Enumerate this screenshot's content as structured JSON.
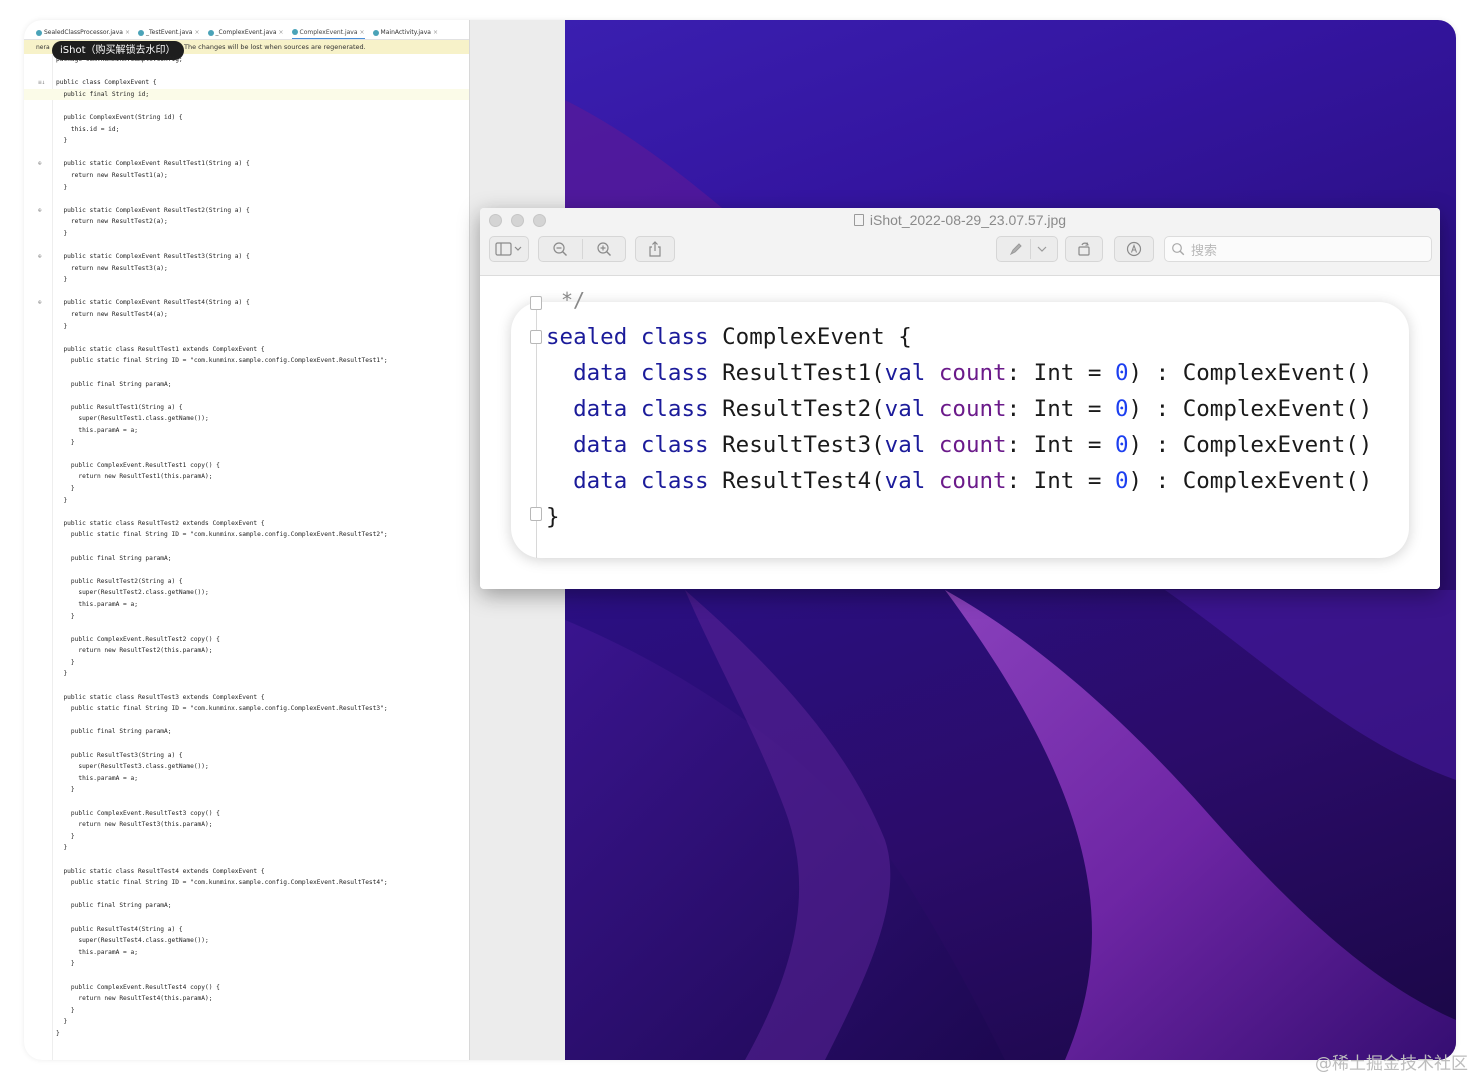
{
  "ide": {
    "tabs": [
      {
        "label": "SealedClassProcessor.java"
      },
      {
        "label": "_TestEvent.java"
      },
      {
        "label": "_ComplexEvent.java"
      },
      {
        "label": "ComplexEvent.java"
      },
      {
        "label": "MainActivity.java"
      }
    ],
    "banner_prefix": "nera",
    "ishot_badge": "iShot（购买解锁去水印）",
    "banner_text": "The changes will be lost when sources are regenerated.",
    "code_lines": [
      "package com.kunminx.sample.config;",
      "",
      "public class ComplexEvent {",
      "  public final String id;",
      "",
      "  public ComplexEvent(String id) {",
      "    this.id = id;",
      "  }",
      "",
      "  public static ComplexEvent ResultTest1(String a) {",
      "    return new ResultTest1(a);",
      "  }",
      "",
      "  public static ComplexEvent ResultTest2(String a) {",
      "    return new ResultTest2(a);",
      "  }",
      "",
      "  public static ComplexEvent ResultTest3(String a) {",
      "    return new ResultTest3(a);",
      "  }",
      "",
      "  public static ComplexEvent ResultTest4(String a) {",
      "    return new ResultTest4(a);",
      "  }",
      "",
      "  public static class ResultTest1 extends ComplexEvent {",
      "    public static final String ID = \"com.kunminx.sample.config.ComplexEvent.ResultTest1\";",
      "",
      "    public final String paramA;",
      "",
      "    public ResultTest1(String a) {",
      "      super(ResultTest1.class.getName());",
      "      this.paramA = a;",
      "    }",
      "",
      "    public ComplexEvent.ResultTest1 copy() {",
      "      return new ResultTest1(this.paramA);",
      "    }",
      "  }",
      "",
      "  public static class ResultTest2 extends ComplexEvent {",
      "    public static final String ID = \"com.kunminx.sample.config.ComplexEvent.ResultTest2\";",
      "",
      "    public final String paramA;",
      "",
      "    public ResultTest2(String a) {",
      "      super(ResultTest2.class.getName());",
      "      this.paramA = a;",
      "    }",
      "",
      "    public ComplexEvent.ResultTest2 copy() {",
      "      return new ResultTest2(this.paramA);",
      "    }",
      "  }",
      "",
      "  public static class ResultTest3 extends ComplexEvent {",
      "    public static final String ID = \"com.kunminx.sample.config.ComplexEvent.ResultTest3\";",
      "",
      "    public final String paramA;",
      "",
      "    public ResultTest3(String a) {",
      "      super(ResultTest3.class.getName());",
      "      this.paramA = a;",
      "    }",
      "",
      "    public ComplexEvent.ResultTest3 copy() {",
      "      return new ResultTest3(this.paramA);",
      "    }",
      "  }",
      "",
      "  public static class ResultTest4 extends ComplexEvent {",
      "    public static final String ID = \"com.kunminx.sample.config.ComplexEvent.ResultTest4\";",
      "",
      "    public final String paramA;",
      "",
      "    public ResultTest4(String a) {",
      "      super(ResultTest4.class.getName());",
      "      this.paramA = a;",
      "    }",
      "",
      "    public ComplexEvent.ResultTest4 copy() {",
      "      return new ResultTest4(this.paramA);",
      "    }",
      "  }",
      "}"
    ]
  },
  "preview": {
    "title": "iShot_2022-08-29_23.07.57.jpg",
    "search_placeholder": "搜索",
    "toolbar_icons": [
      "sidebar-toggle-icon",
      "zoom-out-icon",
      "zoom-in-icon",
      "share-icon",
      "markup-pen-icon",
      "rotate-icon",
      "annotate-icon",
      "search-icon"
    ],
    "code": {
      "partial_top": "*/",
      "lines": [
        [
          [
            "k-kw",
            "sealed"
          ],
          [
            "",
            " "
          ],
          [
            "k-kw",
            "class"
          ],
          [
            "",
            " ComplexEvent {"
          ]
        ],
        [
          [
            "",
            "  "
          ],
          [
            "k-kw",
            "data"
          ],
          [
            "",
            " "
          ],
          [
            "k-kw",
            "class"
          ],
          [
            "",
            " ResultTest1("
          ],
          [
            "k-kw",
            "val"
          ],
          [
            "",
            " "
          ],
          [
            "k-prop",
            "count"
          ],
          [
            "",
            ": Int = "
          ],
          [
            "k-num",
            "0"
          ],
          [
            "",
            ") : ComplexEvent()"
          ]
        ],
        [
          [
            "",
            "  "
          ],
          [
            "k-kw",
            "data"
          ],
          [
            "",
            " "
          ],
          [
            "k-kw",
            "class"
          ],
          [
            "",
            " ResultTest2("
          ],
          [
            "k-kw",
            "val"
          ],
          [
            "",
            " "
          ],
          [
            "k-prop",
            "count"
          ],
          [
            "",
            ": Int = "
          ],
          [
            "k-num",
            "0"
          ],
          [
            "",
            ") : ComplexEvent()"
          ]
        ],
        [
          [
            "",
            "  "
          ],
          [
            "k-kw",
            "data"
          ],
          [
            "",
            " "
          ],
          [
            "k-kw",
            "class"
          ],
          [
            "",
            " ResultTest3("
          ],
          [
            "k-kw",
            "val"
          ],
          [
            "",
            " "
          ],
          [
            "k-prop",
            "count"
          ],
          [
            "",
            ": Int = "
          ],
          [
            "k-num",
            "0"
          ],
          [
            "",
            ") : ComplexEvent()"
          ]
        ],
        [
          [
            "",
            "  "
          ],
          [
            "k-kw",
            "data"
          ],
          [
            "",
            " "
          ],
          [
            "k-kw",
            "class"
          ],
          [
            "",
            " ResultTest4("
          ],
          [
            "k-kw",
            "val"
          ],
          [
            "",
            " "
          ],
          [
            "k-prop",
            "count"
          ],
          [
            "",
            ": Int = "
          ],
          [
            "k-num",
            "0"
          ],
          [
            "",
            ") : ComplexEvent()"
          ]
        ],
        [
          [
            "",
            "}"
          ]
        ]
      ]
    }
  },
  "watermark": "@稀土掘金技术社区",
  "colors": {
    "keyword": "#1b1b9a",
    "property": "#6b1a8a",
    "number": "#1c3ff0",
    "wallpaper": "#2a0f80",
    "banner": "#f7f2c9"
  }
}
